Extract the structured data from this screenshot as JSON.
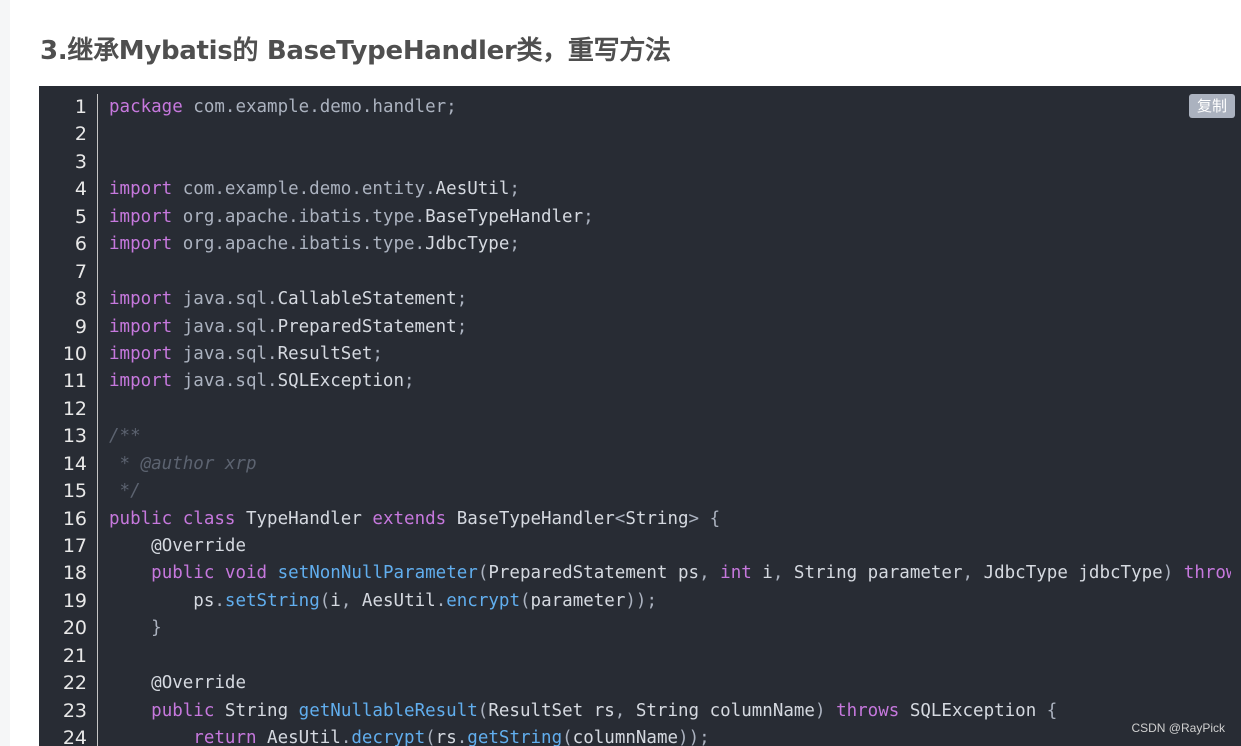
{
  "heading": "3.继承Mybatis的 BaseTypeHandler类，重写方法",
  "copy_button": "复制",
  "watermark": "CSDN @RayPick",
  "colors": {
    "keyword": "#c678dd",
    "function": "#61aeee",
    "comment": "#5c6370",
    "plain": "#abb2bf",
    "background": "#282c34"
  },
  "line_numbers": [
    "1",
    "2",
    "3",
    "4",
    "5",
    "6",
    "7",
    "8",
    "9",
    "10",
    "11",
    "12",
    "13",
    "14",
    "15",
    "16",
    "17",
    "18",
    "19",
    "20",
    "21",
    "22",
    "23",
    "24"
  ],
  "code_lines": [
    [
      {
        "t": "kw",
        "v": "package"
      },
      {
        "t": "pl",
        "v": " com.example.demo.handler;"
      }
    ],
    [],
    [],
    [
      {
        "t": "kw",
        "v": "import"
      },
      {
        "t": "pl",
        "v": " com.example.demo.entity."
      },
      {
        "t": "ty",
        "v": "AesUtil"
      },
      {
        "t": "pl",
        "v": ";"
      }
    ],
    [
      {
        "t": "kw",
        "v": "import"
      },
      {
        "t": "pl",
        "v": " org.apache.ibatis.type."
      },
      {
        "t": "ty",
        "v": "BaseTypeHandler"
      },
      {
        "t": "pl",
        "v": ";"
      }
    ],
    [
      {
        "t": "kw",
        "v": "import"
      },
      {
        "t": "pl",
        "v": " org.apache.ibatis.type."
      },
      {
        "t": "ty",
        "v": "JdbcType"
      },
      {
        "t": "pl",
        "v": ";"
      }
    ],
    [],
    [
      {
        "t": "kw",
        "v": "import"
      },
      {
        "t": "pl",
        "v": " java.sql."
      },
      {
        "t": "ty",
        "v": "CallableStatement"
      },
      {
        "t": "pl",
        "v": ";"
      }
    ],
    [
      {
        "t": "kw",
        "v": "import"
      },
      {
        "t": "pl",
        "v": " java.sql."
      },
      {
        "t": "ty",
        "v": "PreparedStatement"
      },
      {
        "t": "pl",
        "v": ";"
      }
    ],
    [
      {
        "t": "kw",
        "v": "import"
      },
      {
        "t": "pl",
        "v": " java.sql."
      },
      {
        "t": "ty",
        "v": "ResultSet"
      },
      {
        "t": "pl",
        "v": ";"
      }
    ],
    [
      {
        "t": "kw",
        "v": "import"
      },
      {
        "t": "pl",
        "v": " java.sql."
      },
      {
        "t": "ty",
        "v": "SQLException"
      },
      {
        "t": "pl",
        "v": ";"
      }
    ],
    [],
    [
      {
        "t": "cm",
        "v": "/**"
      }
    ],
    [
      {
        "t": "cm",
        "v": " * @author xrp"
      }
    ],
    [
      {
        "t": "cm",
        "v": " */"
      }
    ],
    [
      {
        "t": "kw",
        "v": "public"
      },
      {
        "t": "pl",
        "v": " "
      },
      {
        "t": "kw",
        "v": "class"
      },
      {
        "t": "ty",
        "v": " TypeHandler "
      },
      {
        "t": "kw",
        "v": "extends"
      },
      {
        "t": "ty",
        "v": " BaseTypeHandler"
      },
      {
        "t": "pl",
        "v": "<"
      },
      {
        "t": "ty",
        "v": "String"
      },
      {
        "t": "pl",
        "v": "> {"
      }
    ],
    [
      {
        "t": "pl",
        "v": "    "
      },
      {
        "t": "ty",
        "v": "@Override"
      }
    ],
    [
      {
        "t": "pl",
        "v": "    "
      },
      {
        "t": "kw",
        "v": "public"
      },
      {
        "t": "pl",
        "v": " "
      },
      {
        "t": "kw",
        "v": "void"
      },
      {
        "t": "pl",
        "v": " "
      },
      {
        "t": "fn",
        "v": "setNonNullParameter"
      },
      {
        "t": "pl",
        "v": "("
      },
      {
        "t": "ty",
        "v": "PreparedStatement ps"
      },
      {
        "t": "pl",
        "v": ", "
      },
      {
        "t": "kw",
        "v": "int"
      },
      {
        "t": "ty",
        "v": " i"
      },
      {
        "t": "pl",
        "v": ", "
      },
      {
        "t": "ty",
        "v": "String parameter"
      },
      {
        "t": "pl",
        "v": ", "
      },
      {
        "t": "ty",
        "v": "JdbcType jdbcType"
      },
      {
        "t": "pl",
        "v": ") "
      },
      {
        "t": "kw",
        "v": "throws SQLException {"
      }
    ],
    [
      {
        "t": "pl",
        "v": "        "
      },
      {
        "t": "ty",
        "v": "ps"
      },
      {
        "t": "pl",
        "v": "."
      },
      {
        "t": "fn",
        "v": "setString"
      },
      {
        "t": "pl",
        "v": "("
      },
      {
        "t": "ty",
        "v": "i"
      },
      {
        "t": "pl",
        "v": ", "
      },
      {
        "t": "ty",
        "v": "AesUtil"
      },
      {
        "t": "pl",
        "v": "."
      },
      {
        "t": "fn",
        "v": "encrypt"
      },
      {
        "t": "pl",
        "v": "("
      },
      {
        "t": "ty",
        "v": "parameter"
      },
      {
        "t": "pl",
        "v": "));"
      }
    ],
    [
      {
        "t": "pl",
        "v": "    }"
      }
    ],
    [],
    [
      {
        "t": "pl",
        "v": "    "
      },
      {
        "t": "ty",
        "v": "@Override"
      }
    ],
    [
      {
        "t": "pl",
        "v": "    "
      },
      {
        "t": "kw",
        "v": "public"
      },
      {
        "t": "ty",
        "v": " String "
      },
      {
        "t": "fn",
        "v": "getNullableResult"
      },
      {
        "t": "pl",
        "v": "("
      },
      {
        "t": "ty",
        "v": "ResultSet rs"
      },
      {
        "t": "pl",
        "v": ", "
      },
      {
        "t": "ty",
        "v": "String columnName"
      },
      {
        "t": "pl",
        "v": ") "
      },
      {
        "t": "kw",
        "v": "throws"
      },
      {
        "t": "ty",
        "v": " SQLException "
      },
      {
        "t": "pl",
        "v": "{"
      }
    ],
    [
      {
        "t": "pl",
        "v": "        "
      },
      {
        "t": "kw",
        "v": "return"
      },
      {
        "t": "ty",
        "v": " AesUtil"
      },
      {
        "t": "pl",
        "v": "."
      },
      {
        "t": "fn",
        "v": "decrypt"
      },
      {
        "t": "pl",
        "v": "("
      },
      {
        "t": "ty",
        "v": "rs"
      },
      {
        "t": "pl",
        "v": "."
      },
      {
        "t": "fn",
        "v": "getString"
      },
      {
        "t": "pl",
        "v": "("
      },
      {
        "t": "ty",
        "v": "columnName"
      },
      {
        "t": "pl",
        "v": "));"
      }
    ]
  ]
}
